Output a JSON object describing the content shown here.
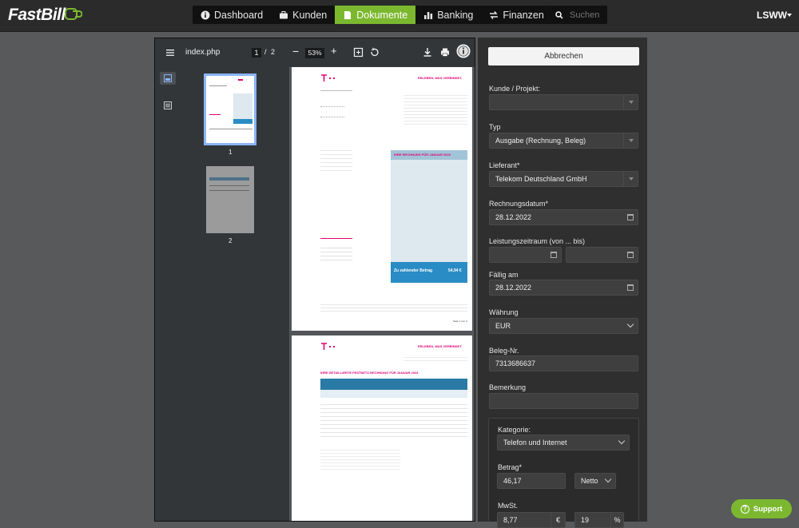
{
  "app": {
    "logo": "FastBill",
    "user": "LSWW"
  },
  "nav": {
    "items": [
      {
        "label": "Dashboard",
        "icon": "info-icon"
      },
      {
        "label": "Kunden",
        "icon": "briefcase-icon"
      },
      {
        "label": "Dokumente",
        "icon": "document-icon",
        "active": true
      },
      {
        "label": "Banking",
        "icon": "bar-chart-icon"
      },
      {
        "label": "Finanzen",
        "icon": "transfer-icon"
      }
    ],
    "search_placeholder": "Suchen"
  },
  "viewer": {
    "file_name": "index.php",
    "current_page": "1",
    "page_separator": "/",
    "total_pages": "2",
    "zoom": "53%",
    "thumb_labels": [
      "1",
      "2"
    ],
    "invoice": {
      "tagline": "ERLEBEN, WAS VERBINDET.",
      "title": "IHRE RECHNUNG FÜR JANUAR 2023",
      "detail_title": "IHRE DETAILLIERTE FESTNETZ-RECHNUNG FÜR JANUAR 2023",
      "amount_label": "Zu zahlender Betrag",
      "amount": "54,94 €",
      "page_footer": "Seite 1 von 3"
    }
  },
  "form": {
    "cancel_label": "Abbrechen",
    "customer_label": "Kunde / Projekt:",
    "customer_value": "",
    "type_label": "Typ",
    "type_value": "Ausgabe (Rechnung, Beleg)",
    "supplier_label": "Lieferant*",
    "supplier_value": "Telekom Deutschland GmbH",
    "invoice_date_label": "Rechnungsdatum*",
    "invoice_date_value": "28.12.2022",
    "service_period_label": "Leistungszeitraum (von ... bis)",
    "due_label": "Fällig am",
    "due_value": "28.12.2022",
    "currency_label": "Währung",
    "currency_value": "EUR",
    "receipt_no_label": "Beleg-Nr.",
    "receipt_no_value": "7313686637",
    "remark_label": "Bemerkung",
    "remark_value": "",
    "category_label": "Kategorie:",
    "category_value": "Telefon und Internet",
    "amount_label": "Betrag*",
    "amount_value": "46,17",
    "net_value": "Netto",
    "vat_label": "MwSt.",
    "vat_amount": "8,77",
    "vat_currency": "€",
    "vat_rate": "19",
    "vat_percent": "%"
  },
  "support_label": "Support"
}
